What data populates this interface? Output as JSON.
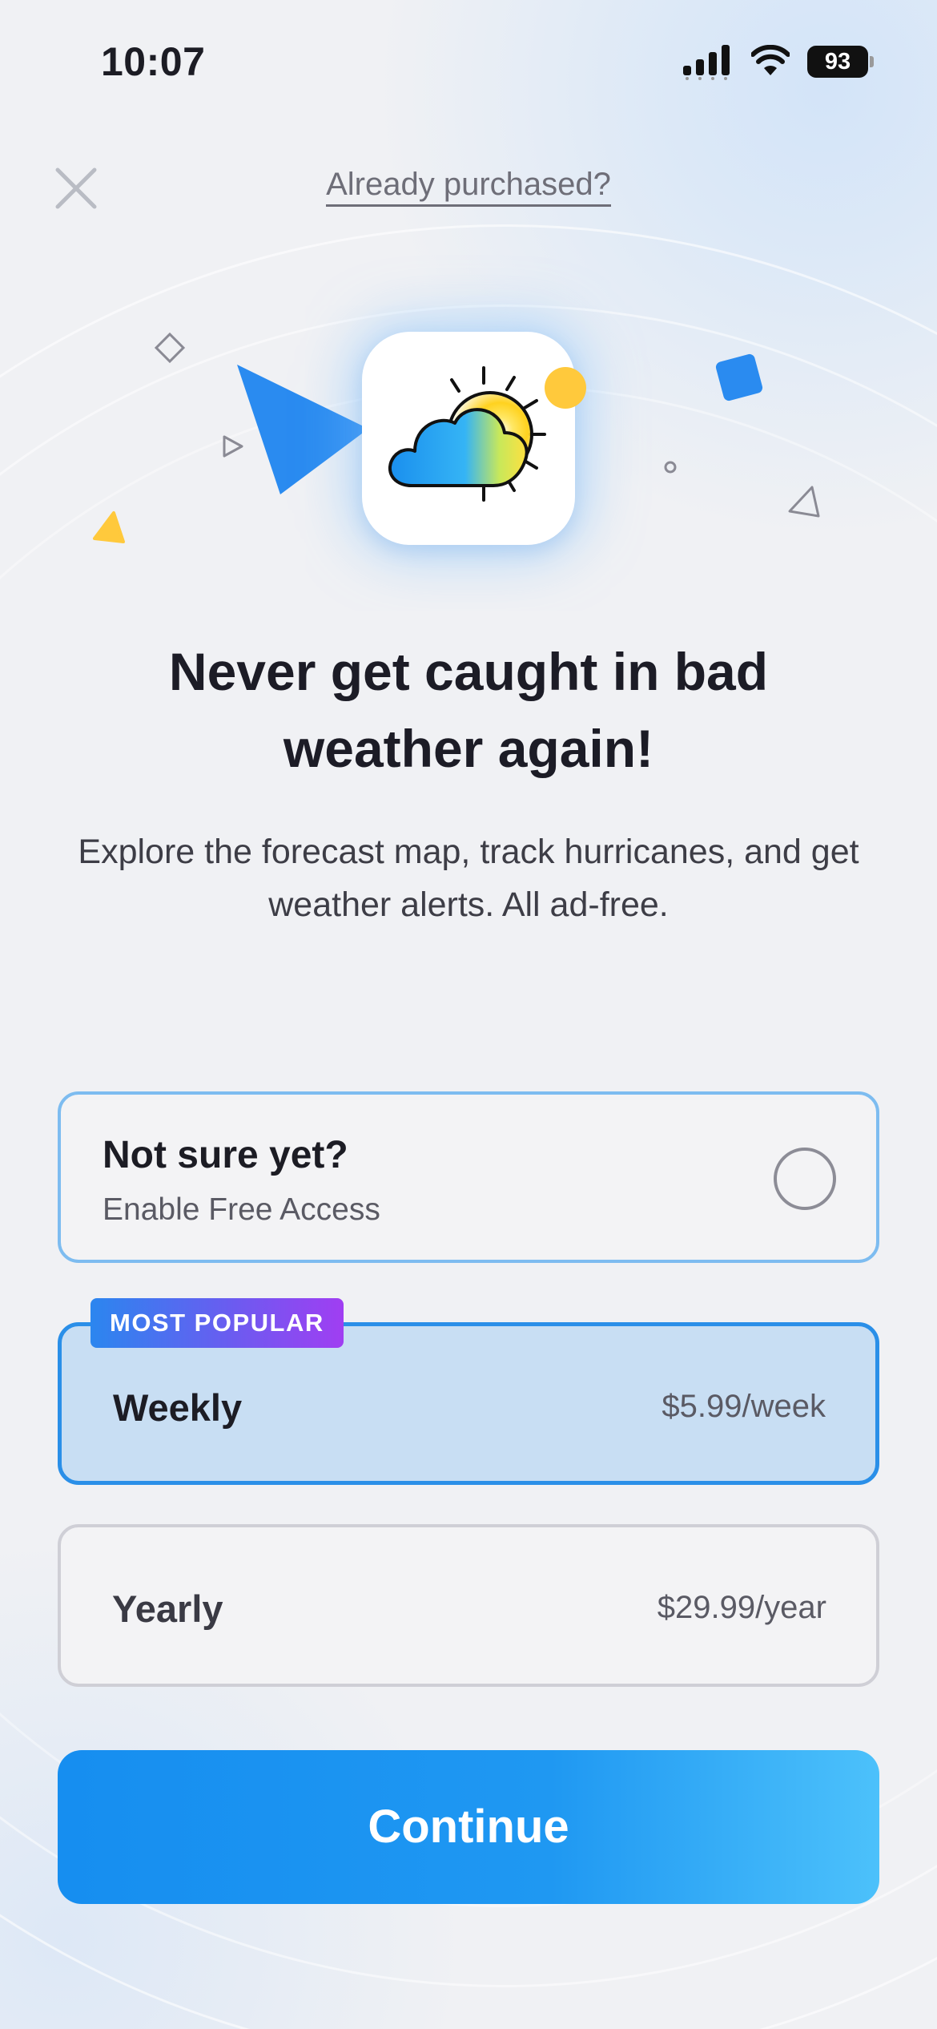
{
  "status_bar": {
    "time": "10:07",
    "battery": "93"
  },
  "header": {
    "restore_label": "Already purchased?"
  },
  "headline": "Never get caught in bad weather again!",
  "subtext": "Explore the forecast map, track hurricanes, and get weather alerts. All ad-free.",
  "plans": {
    "free": {
      "title": "Not sure yet?",
      "subtitle": "Enable Free Access",
      "selected": false
    },
    "weekly": {
      "badge": "MOST POPULAR",
      "title": "Weekly",
      "price": "$5.99/week",
      "selected": true
    },
    "yearly": {
      "title": "Yearly",
      "price": "$29.99/year",
      "selected": false
    }
  },
  "cta": {
    "continue_label": "Continue"
  },
  "colors": {
    "accent": "#1A8FF0",
    "selected_plan_bg": "#C8DEF3",
    "badge_gradient": [
      "#2B86EF",
      "#A03EF2"
    ],
    "sun_yellow": "#FFC93C"
  },
  "icons": [
    "signal-icon",
    "wifi-icon",
    "battery-icon",
    "close-icon",
    "weather-app-icon",
    "radio-unchecked-icon"
  ]
}
